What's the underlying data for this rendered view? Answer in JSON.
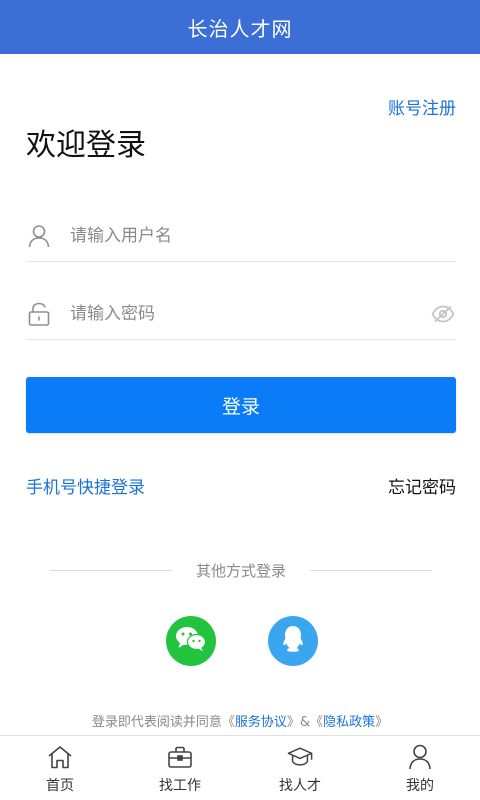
{
  "header": {
    "title": "长治人才网"
  },
  "register_link": "账号注册",
  "welcome": "欢迎登录",
  "form": {
    "username_placeholder": "请输入用户名",
    "password_placeholder": "请输入密码",
    "username_value": "",
    "password_value": "",
    "login_label": "登录"
  },
  "links": {
    "quick_login": "手机号快捷登录",
    "forgot_password": "忘记密码"
  },
  "other_login": {
    "title": "其他方式登录",
    "providers": [
      "wechat-icon",
      "qq-icon"
    ]
  },
  "agreement": {
    "prefix": "登录即代表阅读并同意《",
    "service": "服务协议",
    "mid": "》&《",
    "privacy": "隐私政策",
    "suffix": "》"
  },
  "tabbar": {
    "items": [
      {
        "label": "首页",
        "icon": "home-icon"
      },
      {
        "label": "找工作",
        "icon": "briefcase-icon"
      },
      {
        "label": "找人才",
        "icon": "graduation-cap-icon"
      },
      {
        "label": "我的",
        "icon": "user-icon"
      }
    ]
  },
  "colors": {
    "header": "#3b6fd6",
    "primary": "#0a7cf7",
    "link": "#1a73d9",
    "wechat": "#22c33f",
    "qq": "#3aa6f0"
  }
}
